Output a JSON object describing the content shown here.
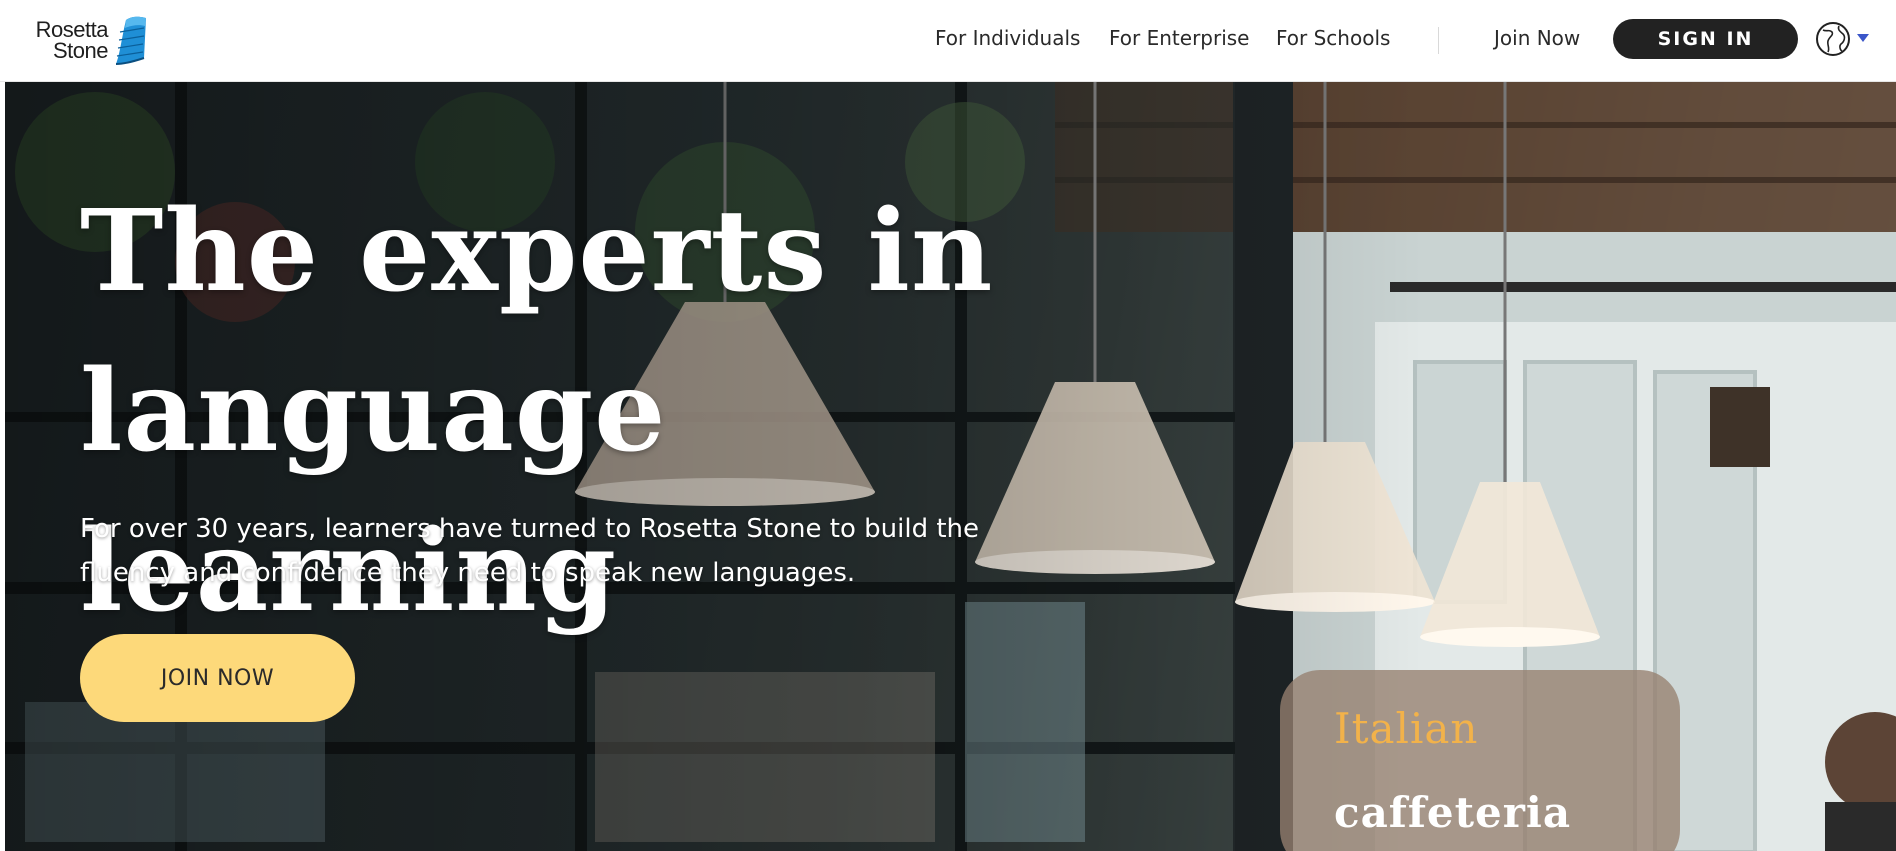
{
  "logo": {
    "line1": "Rosetta",
    "line2": "Stone",
    "icon": "rosetta-stone-logo-mark"
  },
  "nav": {
    "links": [
      {
        "label": "For Individuals"
      },
      {
        "label": "For Enterprise"
      },
      {
        "label": "For Schools"
      }
    ],
    "join_label": "Join Now",
    "signin_label": "SIGN IN",
    "globe_icon": "globe-icon",
    "caret_icon": "caret-down-icon",
    "caret_color": "#3b56c9"
  },
  "hero": {
    "headline_line1": "The experts in",
    "headline_line2": "language learning",
    "subhead": "For over 30 years, learners have turned to Rosetta Stone to build the fluency and confidence they need to speak new languages.",
    "cta_label": "JOIN NOW",
    "cta_color": "#fdd97a",
    "vocab_card": {
      "language": "Italian",
      "word": "caffeteria"
    }
  }
}
